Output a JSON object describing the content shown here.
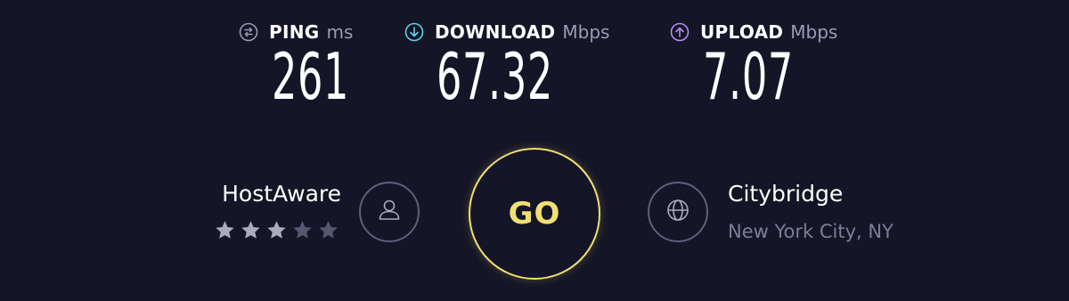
{
  "metrics": {
    "ping": {
      "label": "PING",
      "unit": "ms",
      "value": "261",
      "icon": "ping-icon",
      "color": "#9a9cb3"
    },
    "download": {
      "label": "DOWNLOAD",
      "unit": "Mbps",
      "value": "67.32",
      "icon": "download-arrow-icon",
      "color": "#5fd3e6"
    },
    "upload": {
      "label": "UPLOAD",
      "unit": "Mbps",
      "value": "7.07",
      "icon": "upload-arrow-icon",
      "color": "#b98cf2"
    }
  },
  "provider": {
    "name": "HostAware",
    "rating": {
      "filled": 3,
      "total": 5
    },
    "icon": "user-icon"
  },
  "go_button": {
    "label": "GO",
    "color": "#f2df73"
  },
  "server": {
    "name": "Citybridge",
    "location": "New York City, NY",
    "icon": "globe-icon"
  },
  "colors": {
    "background": "#141526",
    "star_filled": "#a9abbe",
    "star_empty": "#55576e",
    "muted_text": "#7c7e96"
  }
}
